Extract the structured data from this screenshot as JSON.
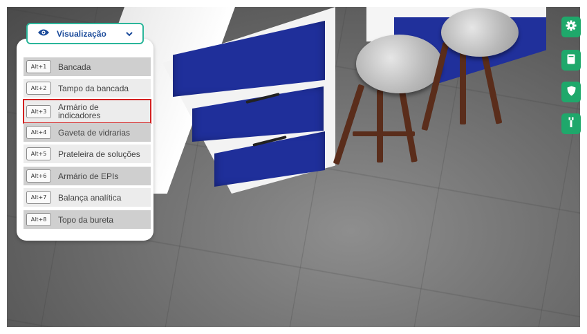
{
  "dropdown": {
    "label": "Visualização",
    "icon": "eye-icon",
    "chevron": "chevron-down-icon"
  },
  "camera_items": [
    {
      "shortcut": "Alt+1",
      "label": "Bancada"
    },
    {
      "shortcut": "Alt+2",
      "label": "Tampo da bancada"
    },
    {
      "shortcut": "Alt+3",
      "label": "Armário de indicadores",
      "selected": true
    },
    {
      "shortcut": "Alt+4",
      "label": "Gaveta de vidrarias"
    },
    {
      "shortcut": "Alt+5",
      "label": "Prateleira de soluções"
    },
    {
      "shortcut": "Alt+6",
      "label": "Armário de EPIs"
    },
    {
      "shortcut": "Alt+7",
      "label": "Balança analítica"
    },
    {
      "shortcut": "Alt+8",
      "label": "Topo da bureta"
    }
  ],
  "toolbar": [
    {
      "icon": "gear-icon"
    },
    {
      "icon": "clipboard-icon"
    },
    {
      "icon": "shield-icon"
    },
    {
      "icon": "pipette-icon"
    }
  ],
  "colors": {
    "accent": "#2bb69a",
    "toolbar": "#1fa86b",
    "selection": "#d32020",
    "label_blue": "#1a4a9a"
  }
}
